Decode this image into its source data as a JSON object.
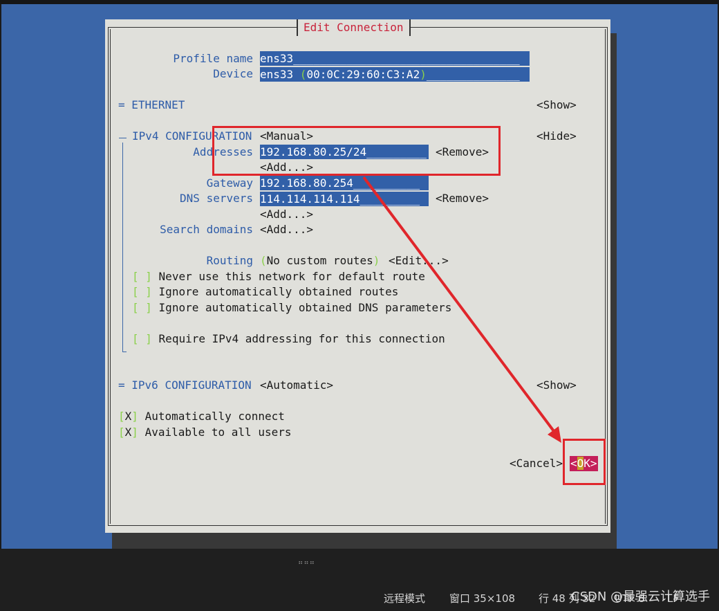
{
  "dialog": {
    "title": "Edit Connection",
    "profile_name_label": "Profile name",
    "profile_name_value": "ens33__________________________________",
    "device_label": "Device",
    "device_value_name": "ens33 ",
    "device_value_mac": "00:0C:29:60:C3:A2",
    "device_value_fill": "______________",
    "ethernet_marker": "=",
    "ethernet_label": "ETHERNET",
    "ethernet_toggle": "<Show>",
    "ipv4_marker": "╤",
    "ipv4_label": "IPv4 CONFIGURATION",
    "ipv4_method": "<Manual>",
    "ipv4_toggle": "<Hide>",
    "addresses_label": "Addresses",
    "addresses_value": "192.168.80.25/24_________",
    "addresses_remove": "<Remove>",
    "addresses_add": "<Add...>",
    "gateway_label": "Gateway",
    "gateway_value": "192.168.80.254__________",
    "dns_label": "DNS servers",
    "dns_value": "114.114.114.114_________",
    "dns_remove": "<Remove>",
    "dns_add": "<Add...>",
    "search_domains_label": "Search domains",
    "search_domains_add": "<Add...>",
    "routing_label": "Routing",
    "routing_value": "No custom routes",
    "routing_edit": "<Edit...>",
    "check_never_default": "Never use this network for default route",
    "check_ignore_routes": "Ignore automatically obtained routes",
    "check_ignore_dns": "Ignore automatically obtained DNS parameters",
    "check_require_ipv4": "Require IPv4 addressing for this connection",
    "ipv6_marker": "=",
    "ipv6_label": "IPv6 CONFIGURATION",
    "ipv6_method": "<Automatic>",
    "ipv6_toggle": "<Show>",
    "auto_connect_mark": "X",
    "auto_connect_label": "Automatically connect",
    "all_users_mark": "X",
    "all_users_label": "Available to all users",
    "cancel_button": "<Cancel>",
    "ok_left": "<",
    "ok_cursor": "O",
    "ok_rest": "K>"
  },
  "statusbar": {
    "grip": "⠶⠶⠶",
    "mode": "远程模式",
    "window": "窗口 35×108",
    "line": "行 48 列 32",
    "encoding": "UTF-8",
    "eol": "LF"
  },
  "watermark": "CSDN @最强云计算选手",
  "colors": {
    "terminal_blue": "#3b66a8",
    "field_blue": "#3260a8",
    "dialog_bg": "#e0e0db",
    "title_red": "#c8223a",
    "ok_magenta": "#c41f59",
    "annotation_red": "#e0262b",
    "checkbox_green": "#8ad04a"
  }
}
